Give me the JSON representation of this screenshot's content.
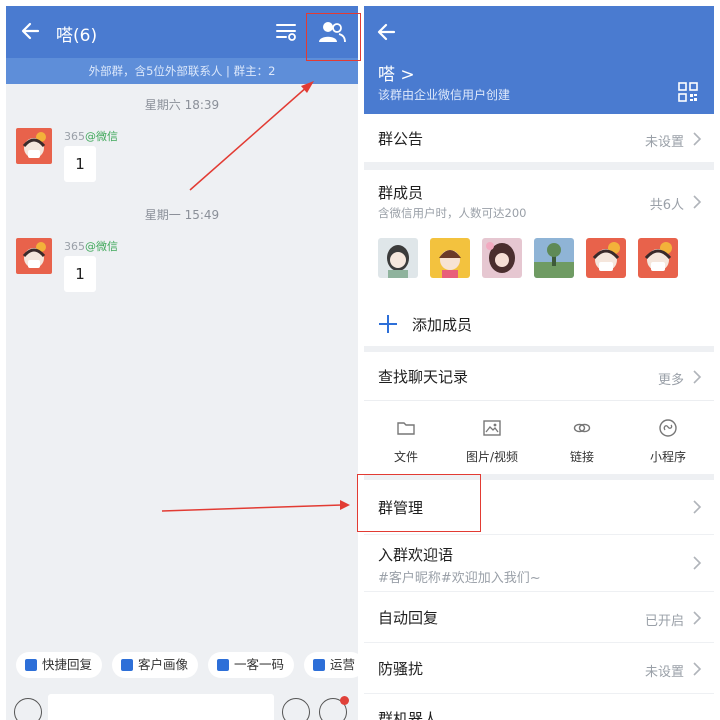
{
  "left": {
    "title": "嗒(6)",
    "subtitle": "外部群，含5位外部联系人 | 群主：2",
    "messages": [
      {
        "time": "星期六 18:39",
        "sender": "365",
        "sender_tag": "@微信",
        "text": "1"
      },
      {
        "time": "星期一 15:49",
        "sender": "365",
        "sender_tag": "@微信",
        "text": "1"
      }
    ],
    "quick_actions": [
      "快捷回复",
      "客户画像",
      "一客一码",
      "运营"
    ]
  },
  "right": {
    "group_name": "嗒 >",
    "group_desc": "该群由企业微信用户创建",
    "announcement": {
      "label": "群公告",
      "value": "未设置"
    },
    "members": {
      "label": "群成员",
      "sub": "含微信用户时，人数可达200",
      "value": "共6人"
    },
    "add_member": "添加成员",
    "search_history": {
      "label": "查找聊天记录",
      "value": "更多"
    },
    "file_types": [
      "文件",
      "图片/视频",
      "链接",
      "小程序"
    ],
    "group_manage": {
      "label": "群管理"
    },
    "welcome": {
      "label": "入群欢迎语",
      "sub": "#客户昵称#欢迎加入我们~"
    },
    "auto_reply": {
      "label": "自动回复",
      "value": "已开启"
    },
    "anti_spam": {
      "label": "防骚扰",
      "value": "未设置"
    },
    "bot": {
      "label": "群机器人"
    }
  },
  "colors": {
    "header_blue": "#4a7bd0",
    "subheader_blue": "#5e8ed9",
    "accent_blue": "#2d6fd8",
    "wechat_green": "#3fa85a",
    "annotation_red": "#e23b33"
  }
}
